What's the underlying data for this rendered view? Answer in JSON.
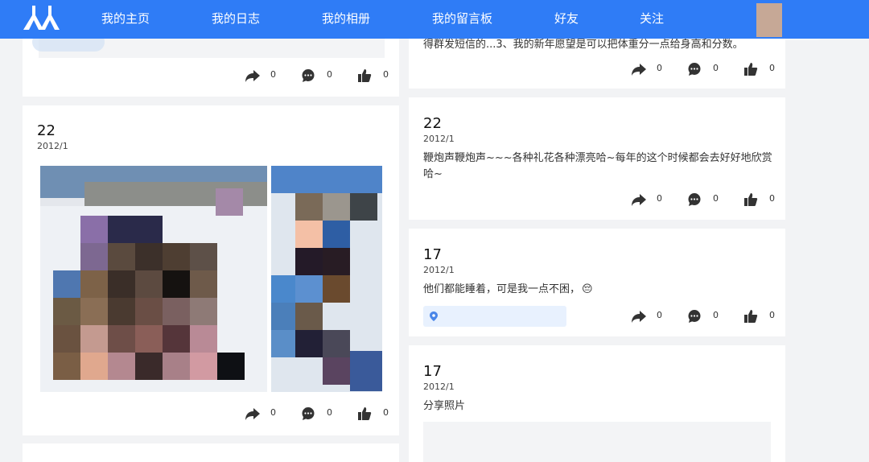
{
  "nav": {
    "items": [
      {
        "label": "我的主页"
      },
      {
        "label": "我的日志"
      },
      {
        "label": "我的相册"
      },
      {
        "label": "我的留言板"
      },
      {
        "label": "好友"
      },
      {
        "label": "关注"
      }
    ]
  },
  "left_posts": [
    {
      "stats": {
        "share": "0",
        "comment": "0",
        "like": "0"
      }
    },
    {
      "day": "22",
      "date": "2012/1",
      "stats": {
        "share": "0",
        "comment": "0",
        "like": "0"
      }
    }
  ],
  "right_posts": [
    {
      "text": "得群发短信的...3、我的新年愿望是可以把体重分一点给身高和分数。",
      "stats": {
        "share": "0",
        "comment": "0",
        "like": "0"
      }
    },
    {
      "day": "22",
      "date": "2012/1",
      "text_line1": "鞭炮声鞭炮声~~~各种礼花各种漂亮哈~每年的这个时候都会去好好地欣赏",
      "text_line2": "哈~",
      "stats": {
        "share": "0",
        "comment": "0",
        "like": "0"
      }
    },
    {
      "day": "17",
      "date": "2012/1",
      "text": "他们都能睡着，可是我一点不困，",
      "emoji": "😔",
      "stats": {
        "share": "0",
        "comment": "0",
        "like": "0"
      }
    },
    {
      "day": "17",
      "date": "2012/1",
      "text": "分享照片"
    }
  ],
  "icons": {
    "logo": "renren-logo-icon",
    "share": "share-arrow-icon",
    "comment": "comment-bubble-icon",
    "like": "thumbs-up-icon",
    "location": "location-pin-icon"
  },
  "colors": {
    "nav_bg": "#2f7cf6",
    "page_bg": "#f2f3f5",
    "card_bg": "#ffffff",
    "location_bg": "#e8f1fe"
  }
}
